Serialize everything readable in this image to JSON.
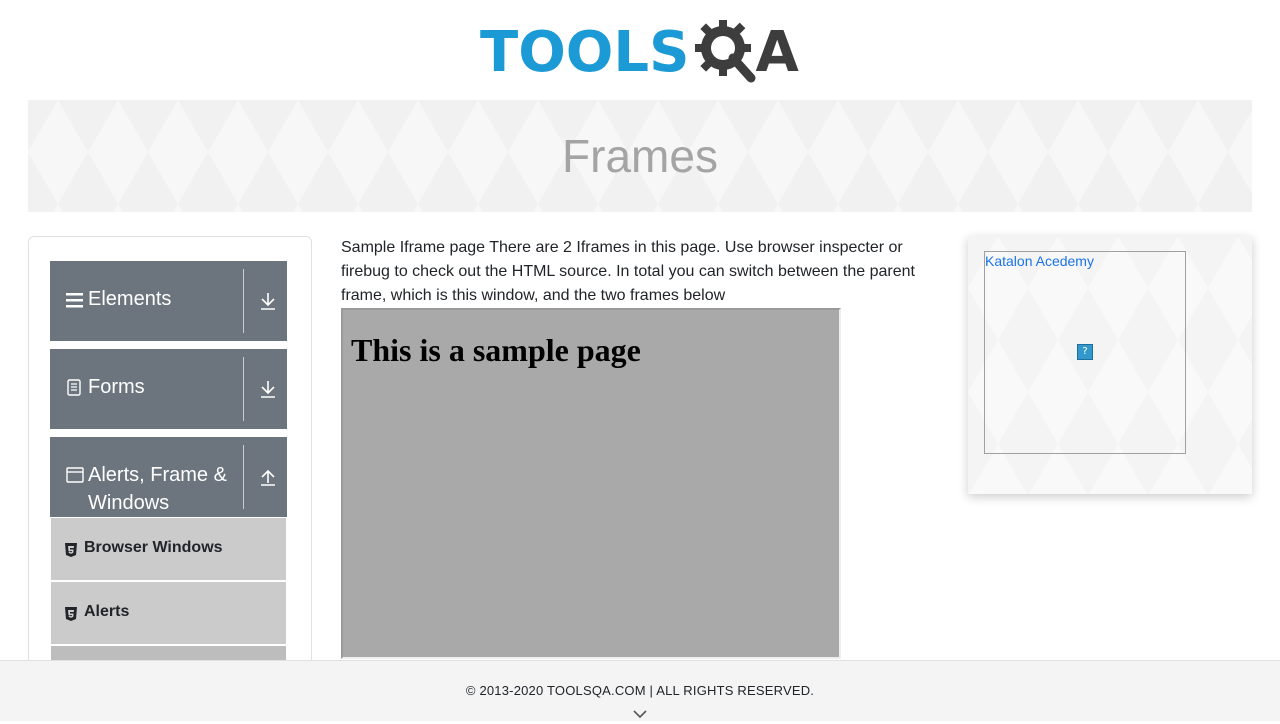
{
  "header": {
    "logo_text": "TOOLS",
    "logo_suffix": "A",
    "logo_icon": "gear-magnifier-icon",
    "brand_color": "#1b9ad6"
  },
  "banner": {
    "title": "Frames"
  },
  "sidebar": {
    "groups": [
      {
        "label": "Elements",
        "icon": "hamburger-icon",
        "toggle_icon": "download-arrow-icon"
      },
      {
        "label": "Forms",
        "icon": "document-icon",
        "toggle_icon": "download-arrow-icon"
      },
      {
        "label": "Alerts, Frame & Windows",
        "icon": "window-icon",
        "toggle_icon": "upload-arrow-icon"
      }
    ],
    "items": [
      {
        "label": "Browser Windows",
        "icon": "html5-icon"
      },
      {
        "label": "Alerts",
        "icon": "html5-icon"
      }
    ],
    "header_color": "#6c757d",
    "item_color": "#cbcbcb"
  },
  "main": {
    "intro": "Sample Iframe page There are 2 Iframes in this page. Use browser inspecter or firebug to check out the HTML source. In total you can switch between the parent frame, which is this window, and the two frames below",
    "frame1_heading": "This is a sample page",
    "frame1_bg": "#a9a9a9"
  },
  "ad": {
    "link_text": "Katalon Acedemy",
    "broken_image_glyph": "?"
  },
  "footer": {
    "text": "© 2013-2020 TOOLSQA.COM | ALL RIGHTS RESERVED.",
    "chevron_icon": "chevron-down-icon"
  }
}
